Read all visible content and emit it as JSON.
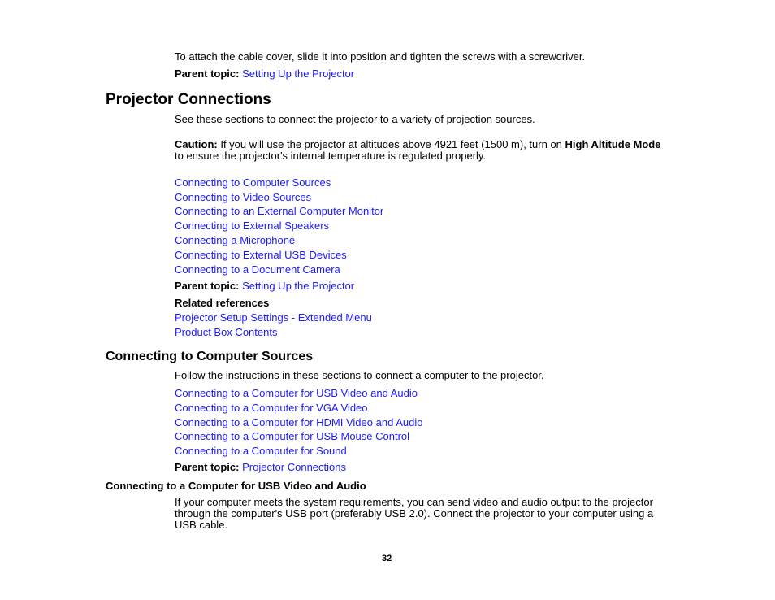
{
  "intro": {
    "text": "To attach the cable cover, slide it into position and tighten the screws with a screwdriver.",
    "parent_label": "Parent topic:",
    "parent_link": "Setting Up the Projector"
  },
  "projector_connections": {
    "heading": "Projector Connections",
    "description": "See these sections to connect the projector to a variety of projection sources.",
    "caution_label": "Caution:",
    "caution_text_1": " If you will use the projector at altitudes above 4921 feet (1500 m), turn on ",
    "caution_bold": "High Altitude Mode",
    "caution_text_2": "to ensure the projector's internal temperature is regulated properly.",
    "links": [
      "Connecting to Computer Sources",
      "Connecting to Video Sources",
      "Connecting to an External Computer Monitor",
      "Connecting to External Speakers",
      "Connecting a Microphone",
      "Connecting to External USB Devices",
      "Connecting to a Document Camera"
    ],
    "parent_label": "Parent topic:",
    "parent_link": "Setting Up the Projector",
    "related_label": "Related references",
    "related_links": [
      "Projector Setup Settings - Extended Menu",
      "Product Box Contents"
    ]
  },
  "computer_sources": {
    "heading": "Connecting to Computer Sources",
    "description": "Follow the instructions in these sections to connect a computer to the projector.",
    "links": [
      "Connecting to a Computer for USB Video and Audio",
      "Connecting to a Computer for VGA Video",
      "Connecting to a Computer for HDMI Video and Audio",
      "Connecting to a Computer for USB Mouse Control",
      "Connecting to a Computer for Sound"
    ],
    "parent_label": "Parent topic:",
    "parent_link": "Projector Connections"
  },
  "usb_video_audio": {
    "heading": "Connecting to a Computer for USB Video and Audio",
    "line_1": "If your computer meets the system requirements, you can send video and audio output to the projector",
    "line_2": "through the computer's USB port (preferably USB 2.0). Connect the projector to your computer using a",
    "line_3": "USB cable."
  },
  "footer": {
    "page_number": "32"
  },
  "colors": {
    "link": "#1a1aff",
    "text": "#000000"
  }
}
